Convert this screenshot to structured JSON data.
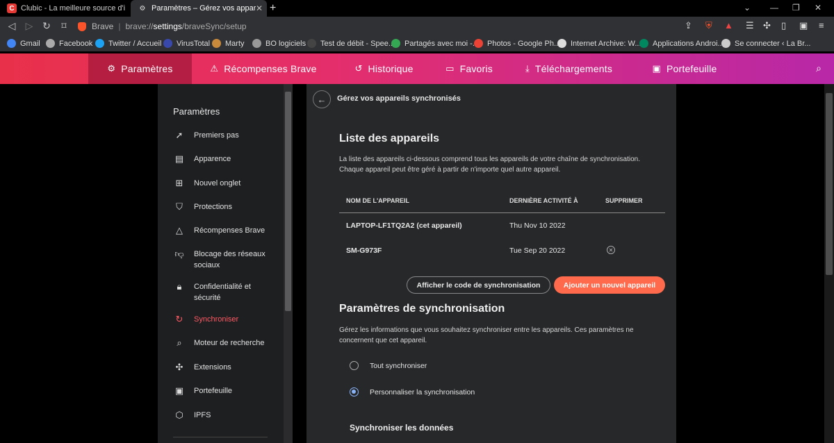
{
  "tabs": [
    {
      "title": "Clubic - La meilleure source d'informa",
      "favicon": "C",
      "active": false
    },
    {
      "title": "Paramètres – Gérez vos appareils",
      "active": true
    }
  ],
  "window_controls": {
    "dropdown": "⌄",
    "minimize": "—",
    "restore": "❐",
    "close": "✕"
  },
  "address": {
    "brand": "Brave",
    "prefix": "brave://",
    "bold": "settings",
    "suffix": "/braveSync/setup"
  },
  "bookmarks": [
    {
      "label": "Gmail",
      "color": "#4285f4"
    },
    {
      "label": "Facebook",
      "color": "#aaaaaa"
    },
    {
      "label": "Twitter / Accueil",
      "color": "#1da1f2"
    },
    {
      "label": "VirusTotal",
      "color": "#3949ab"
    },
    {
      "label": "Marty",
      "color": "#c98a3b"
    },
    {
      "label": "BO logiciels",
      "color": "#999999"
    },
    {
      "label": "Test de débit - Spee...",
      "color": "#444444"
    },
    {
      "label": "Partagés avec moi -...",
      "color": "#34a853"
    },
    {
      "label": "Photos - Google Ph...",
      "color": "#ea4335"
    },
    {
      "label": "Internet Archive: W...",
      "color": "#dddddd"
    },
    {
      "label": "Applications Androi...",
      "color": "#01875f"
    },
    {
      "label": "Se connecter ‹ La Br...",
      "color": "#cccccc"
    }
  ],
  "topnav": [
    {
      "label": "Paramètres",
      "icon": "gear-icon",
      "glyph": "⚙"
    },
    {
      "label": "Récompenses Brave",
      "icon": "triangle-icon",
      "glyph": "⚠"
    },
    {
      "label": "Historique",
      "icon": "history-icon",
      "glyph": "↺"
    },
    {
      "label": "Favoris",
      "icon": "bookmark-icon",
      "glyph": "▭"
    },
    {
      "label": "Téléchargements",
      "icon": "download-icon",
      "glyph": "⤓"
    },
    {
      "label": "Portefeuille",
      "icon": "wallet-icon",
      "glyph": "▣"
    }
  ],
  "sidebar": {
    "title": "Paramètres",
    "items": [
      {
        "label": "Premiers pas",
        "icon": "rocket-icon",
        "glyph": "➚"
      },
      {
        "label": "Apparence",
        "icon": "appearance-icon",
        "glyph": "▤"
      },
      {
        "label": "Nouvel onglet",
        "icon": "new-tab-icon",
        "glyph": "⊞"
      },
      {
        "label": "Protections",
        "icon": "shield-icon",
        "glyph": "⛉"
      },
      {
        "label": "Récompenses Brave",
        "icon": "rewards-icon",
        "glyph": "△"
      },
      {
        "label": "Blocage des réseaux sociaux",
        "icon": "thumb-down-icon",
        "glyph": "👎︎"
      },
      {
        "label": "Confidentialité et sécurité",
        "icon": "lock-icon",
        "glyph": "🔒︎"
      },
      {
        "label": "Synchroniser",
        "icon": "sync-icon",
        "glyph": "↻"
      },
      {
        "label": "Moteur de recherche",
        "icon": "search-icon",
        "glyph": "⌕"
      },
      {
        "label": "Extensions",
        "icon": "puzzle-icon",
        "glyph": "✣"
      },
      {
        "label": "Portefeuille",
        "icon": "wallet-icon",
        "glyph": "▣"
      },
      {
        "label": "IPFS",
        "icon": "ipfs-icon",
        "glyph": "⬡"
      }
    ]
  },
  "main": {
    "header": "Gérez vos appareils synchronisés",
    "devices_title": "Liste des appareils",
    "devices_desc": "La liste des appareils ci-dessous comprend tous les appareils de votre chaîne de synchronisation. Chaque appareil peut être géré à partir de n'importe quel autre appareil.",
    "columns": [
      "NOM DE L'APPAREIL",
      "DERNIÈRE ACTIVITÉ À",
      "SUPPRIMER"
    ],
    "rows": [
      {
        "name": "LAPTOP-LF1TQ2A2 (cet appareil)",
        "last": "Thu Nov 10 2022",
        "deletable": false
      },
      {
        "name": "SM-G973F",
        "last": "Tue Sep 20 2022",
        "deletable": true
      }
    ],
    "btn_show_code": "Afficher le code de synchronisation",
    "btn_add": "Ajouter un nouvel appareil",
    "sync_title": "Paramètres de synchronisation",
    "sync_desc": "Gérez les informations que vous souhaitez synchroniser entre les appareils. Ces paramètres ne concernent que cet appareil.",
    "radio_all": "Tout synchroniser",
    "radio_custom": "Personnaliser la synchronisation",
    "data_title": "Synchroniser les données"
  }
}
